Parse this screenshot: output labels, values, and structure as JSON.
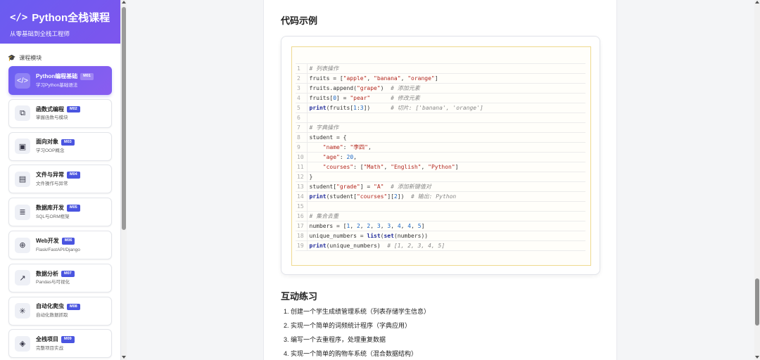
{
  "brand": {
    "title": "Python全栈课程",
    "subtitle": "从零基础到全栈工程师",
    "icon": "code-icon"
  },
  "sidebar": {
    "section_label": "课程模块",
    "modules": [
      {
        "title": "Python编程基础",
        "badge": "M01",
        "subtitle": "学习Python基础语法",
        "icon": "code-icon",
        "active": true
      },
      {
        "title": "函数式编程",
        "badge": "M02",
        "subtitle": "掌握函数与模块",
        "icon": "cubes-icon",
        "active": false
      },
      {
        "title": "面向对象",
        "badge": "M03",
        "subtitle": "学习OOP概念",
        "icon": "object-group-icon",
        "active": false
      },
      {
        "title": "文件与异常",
        "badge": "M04",
        "subtitle": "文件操作与异常",
        "icon": "file-icon",
        "active": false
      },
      {
        "title": "数据库开发",
        "badge": "M05",
        "subtitle": "SQL与ORM框架",
        "icon": "database-icon",
        "active": false
      },
      {
        "title": "Web开发",
        "badge": "M06",
        "subtitle": "Flask/FastAPI/Django",
        "icon": "globe-icon",
        "active": false
      },
      {
        "title": "数据分析",
        "badge": "M07",
        "subtitle": "Pandas与可视化",
        "icon": "chart-line-icon",
        "active": false
      },
      {
        "title": "自动化爬虫",
        "badge": "M08",
        "subtitle": "自动化数据抓取",
        "icon": "spider-icon",
        "active": false
      },
      {
        "title": "全栈项目",
        "badge": "M09",
        "subtitle": "完整项目实战",
        "icon": "layers-icon",
        "active": false
      }
    ]
  },
  "main": {
    "code_heading": "代码示例",
    "exercise_heading": "互动练习",
    "exercises": [
      "1. 创建一个学生成绩管理系统（列表存储学生信息）",
      "2. 实现一个简单的词频统计程序（字典应用）",
      "3. 编写一个去重程序，处理重复数据",
      "4. 实现一个简单的购物车系统（混合数据结构）"
    ],
    "code_lines": [
      {
        "n": "1",
        "html": "<span class=\"c-com\"># 列表操作</span>"
      },
      {
        "n": "2",
        "html": "fruits = [<span class=\"c-str\">\"apple\"</span>, <span class=\"c-str\">\"banana\"</span>, <span class=\"c-str\">\"orange\"</span>]"
      },
      {
        "n": "3",
        "html": "fruits.append(<span class=\"c-str\">\"grape\"</span>)  <span class=\"c-com\"># 添加元素</span>"
      },
      {
        "n": "4",
        "html": "fruits[<span class=\"c-num\">0</span>] = <span class=\"c-str\">\"pear\"</span>      <span class=\"c-com\"># 修改元素</span>"
      },
      {
        "n": "5",
        "html": "<span class=\"c-kw\">print</span>(fruits[<span class=\"c-num\">1</span>:<span class=\"c-num\">3</span>])      <span class=\"c-com\"># 切片: ['banana', 'orange']</span>"
      },
      {
        "n": "6",
        "html": ""
      },
      {
        "n": "7",
        "html": "<span class=\"c-com\"># 字典操作</span>"
      },
      {
        "n": "8",
        "html": "student = {"
      },
      {
        "n": "9",
        "html": "    <span class=\"c-str\">\"name\"</span>: <span class=\"c-str\">\"李四\"</span>,"
      },
      {
        "n": "10",
        "html": "    <span class=\"c-str\">\"age\"</span>: <span class=\"c-num\">20</span>,"
      },
      {
        "n": "11",
        "html": "    <span class=\"c-str\">\"courses\"</span>: [<span class=\"c-str\">\"Math\"</span>, <span class=\"c-str\">\"English\"</span>, <span class=\"c-str\">\"Python\"</span>]"
      },
      {
        "n": "12",
        "html": "}"
      },
      {
        "n": "13",
        "html": "student[<span class=\"c-str\">\"grade\"</span>] = <span class=\"c-str\">\"A\"</span>  <span class=\"c-com\"># 添加新键值对</span>"
      },
      {
        "n": "14",
        "html": "<span class=\"c-kw\">print</span>(student[<span class=\"c-str\">\"courses\"</span>][<span class=\"c-num\">2</span>])  <span class=\"c-com\"># 输出: Python</span>"
      },
      {
        "n": "15",
        "html": ""
      },
      {
        "n": "16",
        "html": "<span class=\"c-com\"># 集合去重</span>"
      },
      {
        "n": "17",
        "html": "numbers = [<span class=\"c-num\">1</span>, <span class=\"c-num\">2</span>, <span class=\"c-num\">2</span>, <span class=\"c-num\">3</span>, <span class=\"c-num\">3</span>, <span class=\"c-num\">4</span>, <span class=\"c-num\">4</span>, <span class=\"c-num\">5</span>]"
      },
      {
        "n": "18",
        "html": "unique_numbers = <span class=\"c-kw\">list</span>(<span class=\"c-kw\">set</span>(numbers))"
      },
      {
        "n": "19",
        "html": "<span class=\"c-kw\">print</span>(unique_numbers)  <span class=\"c-com\"># [1, 2, 3, 4, 5]</span>"
      }
    ]
  },
  "colors": {
    "accent": "#6a5cf0",
    "badge": "#4a55e0",
    "code_border": "#efd98f"
  }
}
